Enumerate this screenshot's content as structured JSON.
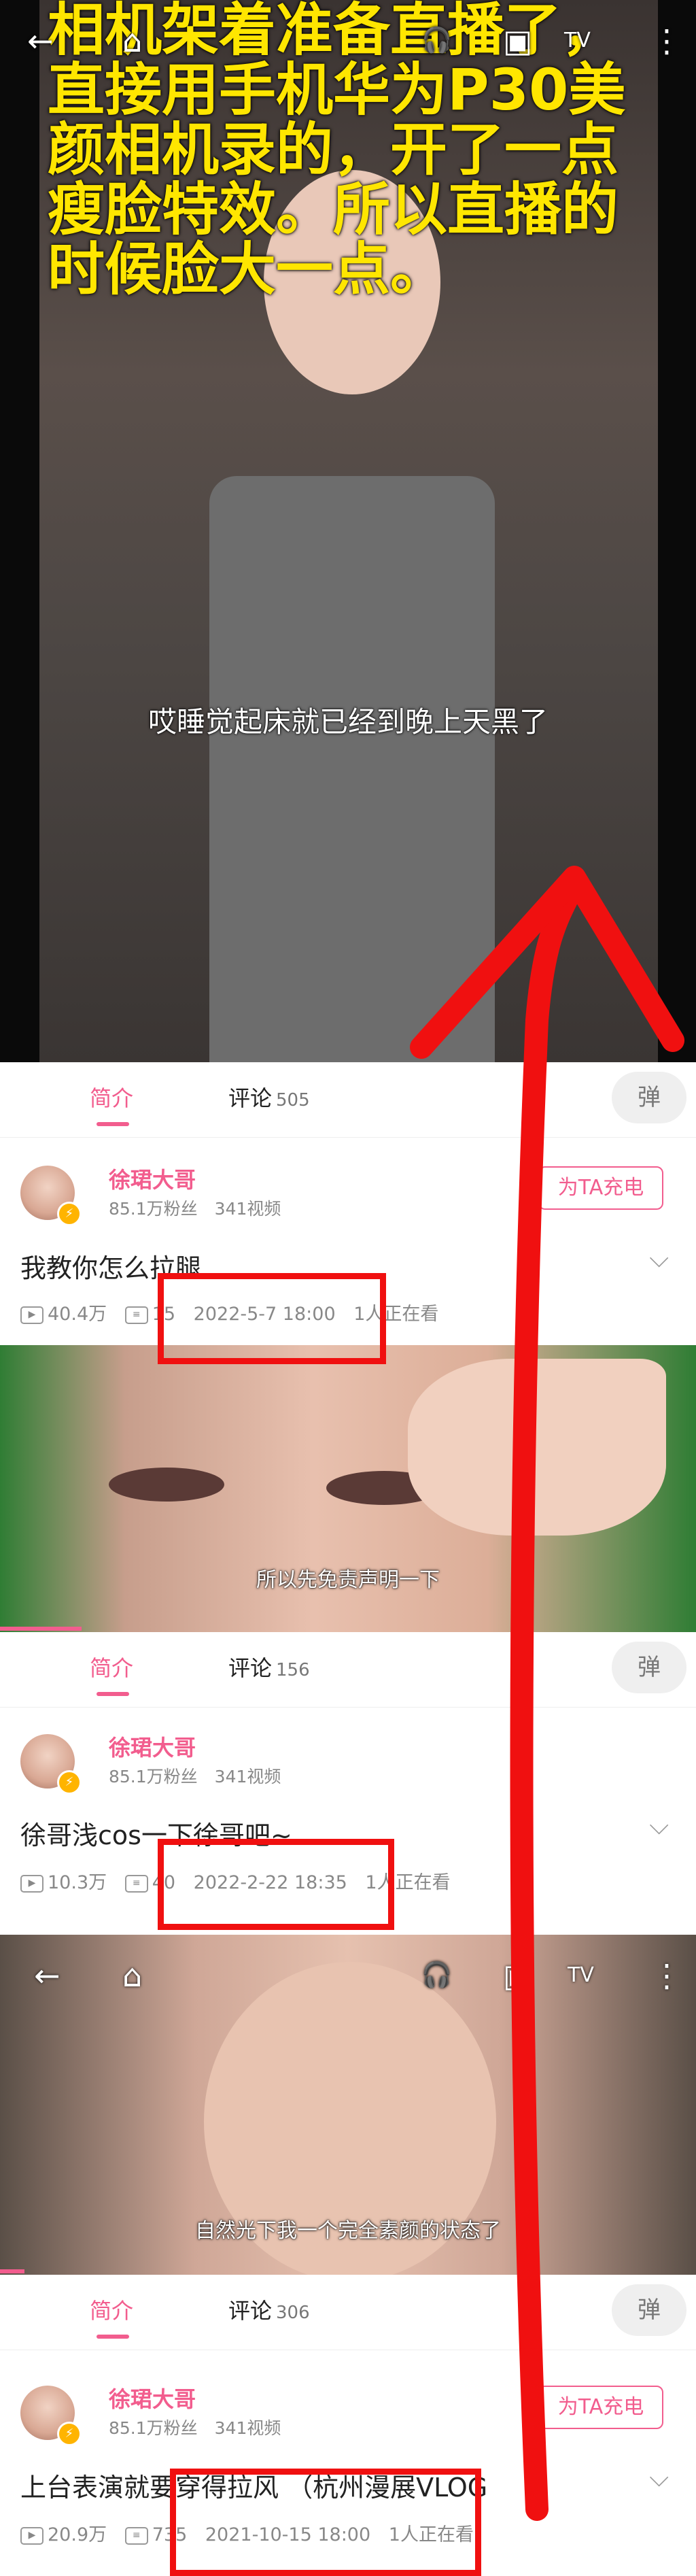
{
  "top_caption": "相机架着准备直播了，直接用手机华为P30美颜相机录的，开了一点瘦脸特效。所以直播的时候脸大一点。",
  "panels": [
    {
      "subtitle": "哎睡觉起床就已经到晚上天黑了",
      "tabs": {
        "intro": "简介",
        "comments": "评论",
        "comment_count": "505"
      },
      "author": {
        "name": "徐珺大哥",
        "stats": "85.1万粉丝　341视频"
      },
      "charge_label": "为TA充电",
      "title": "我教你怎么拉腿",
      "meta": {
        "views": "40.4万",
        "danmaku": "15",
        "date": "2022-5-7 18:00",
        "watching": "1人正在看"
      }
    },
    {
      "subtitle": "所以先免责声明一下",
      "tabs": {
        "intro": "简介",
        "comments": "评论",
        "comment_count": "156"
      },
      "author": {
        "name": "徐珺大哥",
        "stats": "85.1万粉丝　341视频"
      },
      "charge_label": "",
      "title": "徐哥浅cos一下徐哥吧~",
      "meta": {
        "views": "10.3万",
        "danmaku": "40",
        "date": "2022-2-22 18:35",
        "watching": "1人正在看"
      }
    },
    {
      "subtitle": "自然光下我一个完全素颜的状态了",
      "tabs": {
        "intro": "简介",
        "comments": "评论",
        "comment_count": "306"
      },
      "author": {
        "name": "徐珺大哥",
        "stats": "85.1万粉丝　341视频"
      },
      "charge_label": "为TA充电",
      "title": "上台表演就要穿得拉风 （杭州漫展VLOG",
      "meta": {
        "views": "20.9万",
        "danmaku": "735",
        "date": "2021-10-15 18:00",
        "watching": "1人正在看"
      }
    }
  ],
  "icons": {
    "back": "←",
    "home": "⌂",
    "headphones": "🎧",
    "pip": "▣",
    "tv": "TV",
    "more": "⋮",
    "chevron": "⌵",
    "danmaku_toggle": "弹"
  },
  "colors": {
    "accent": "#f25d8e",
    "annotation": "#f01010"
  }
}
